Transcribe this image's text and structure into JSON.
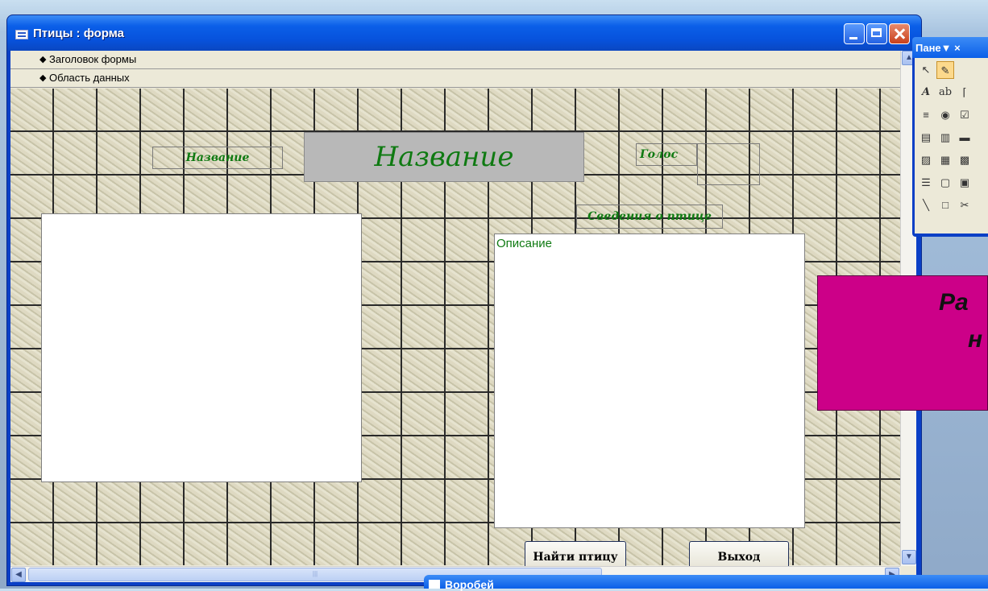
{
  "window": {
    "title": "Птицы : форма"
  },
  "sections": {
    "header": "Заголовок формы",
    "detail": "Область данных"
  },
  "form": {
    "name_label_small": "Название",
    "name_label_big": "Название",
    "voice_label": "Голос",
    "info_label": "Сведения о птице",
    "description_text": "Описание",
    "find_button": "Найти птицу",
    "exit_button": "Выход"
  },
  "toolbox": {
    "title": "Пане▼ ×"
  },
  "note": {
    "line1": "Ра",
    "line2": "н"
  },
  "second_window": {
    "title": "Воробей"
  },
  "icons": {
    "window_icon": "form-icon",
    "pointer_tool": "pointer-icon",
    "wizard_tool": "wizard-icon"
  }
}
